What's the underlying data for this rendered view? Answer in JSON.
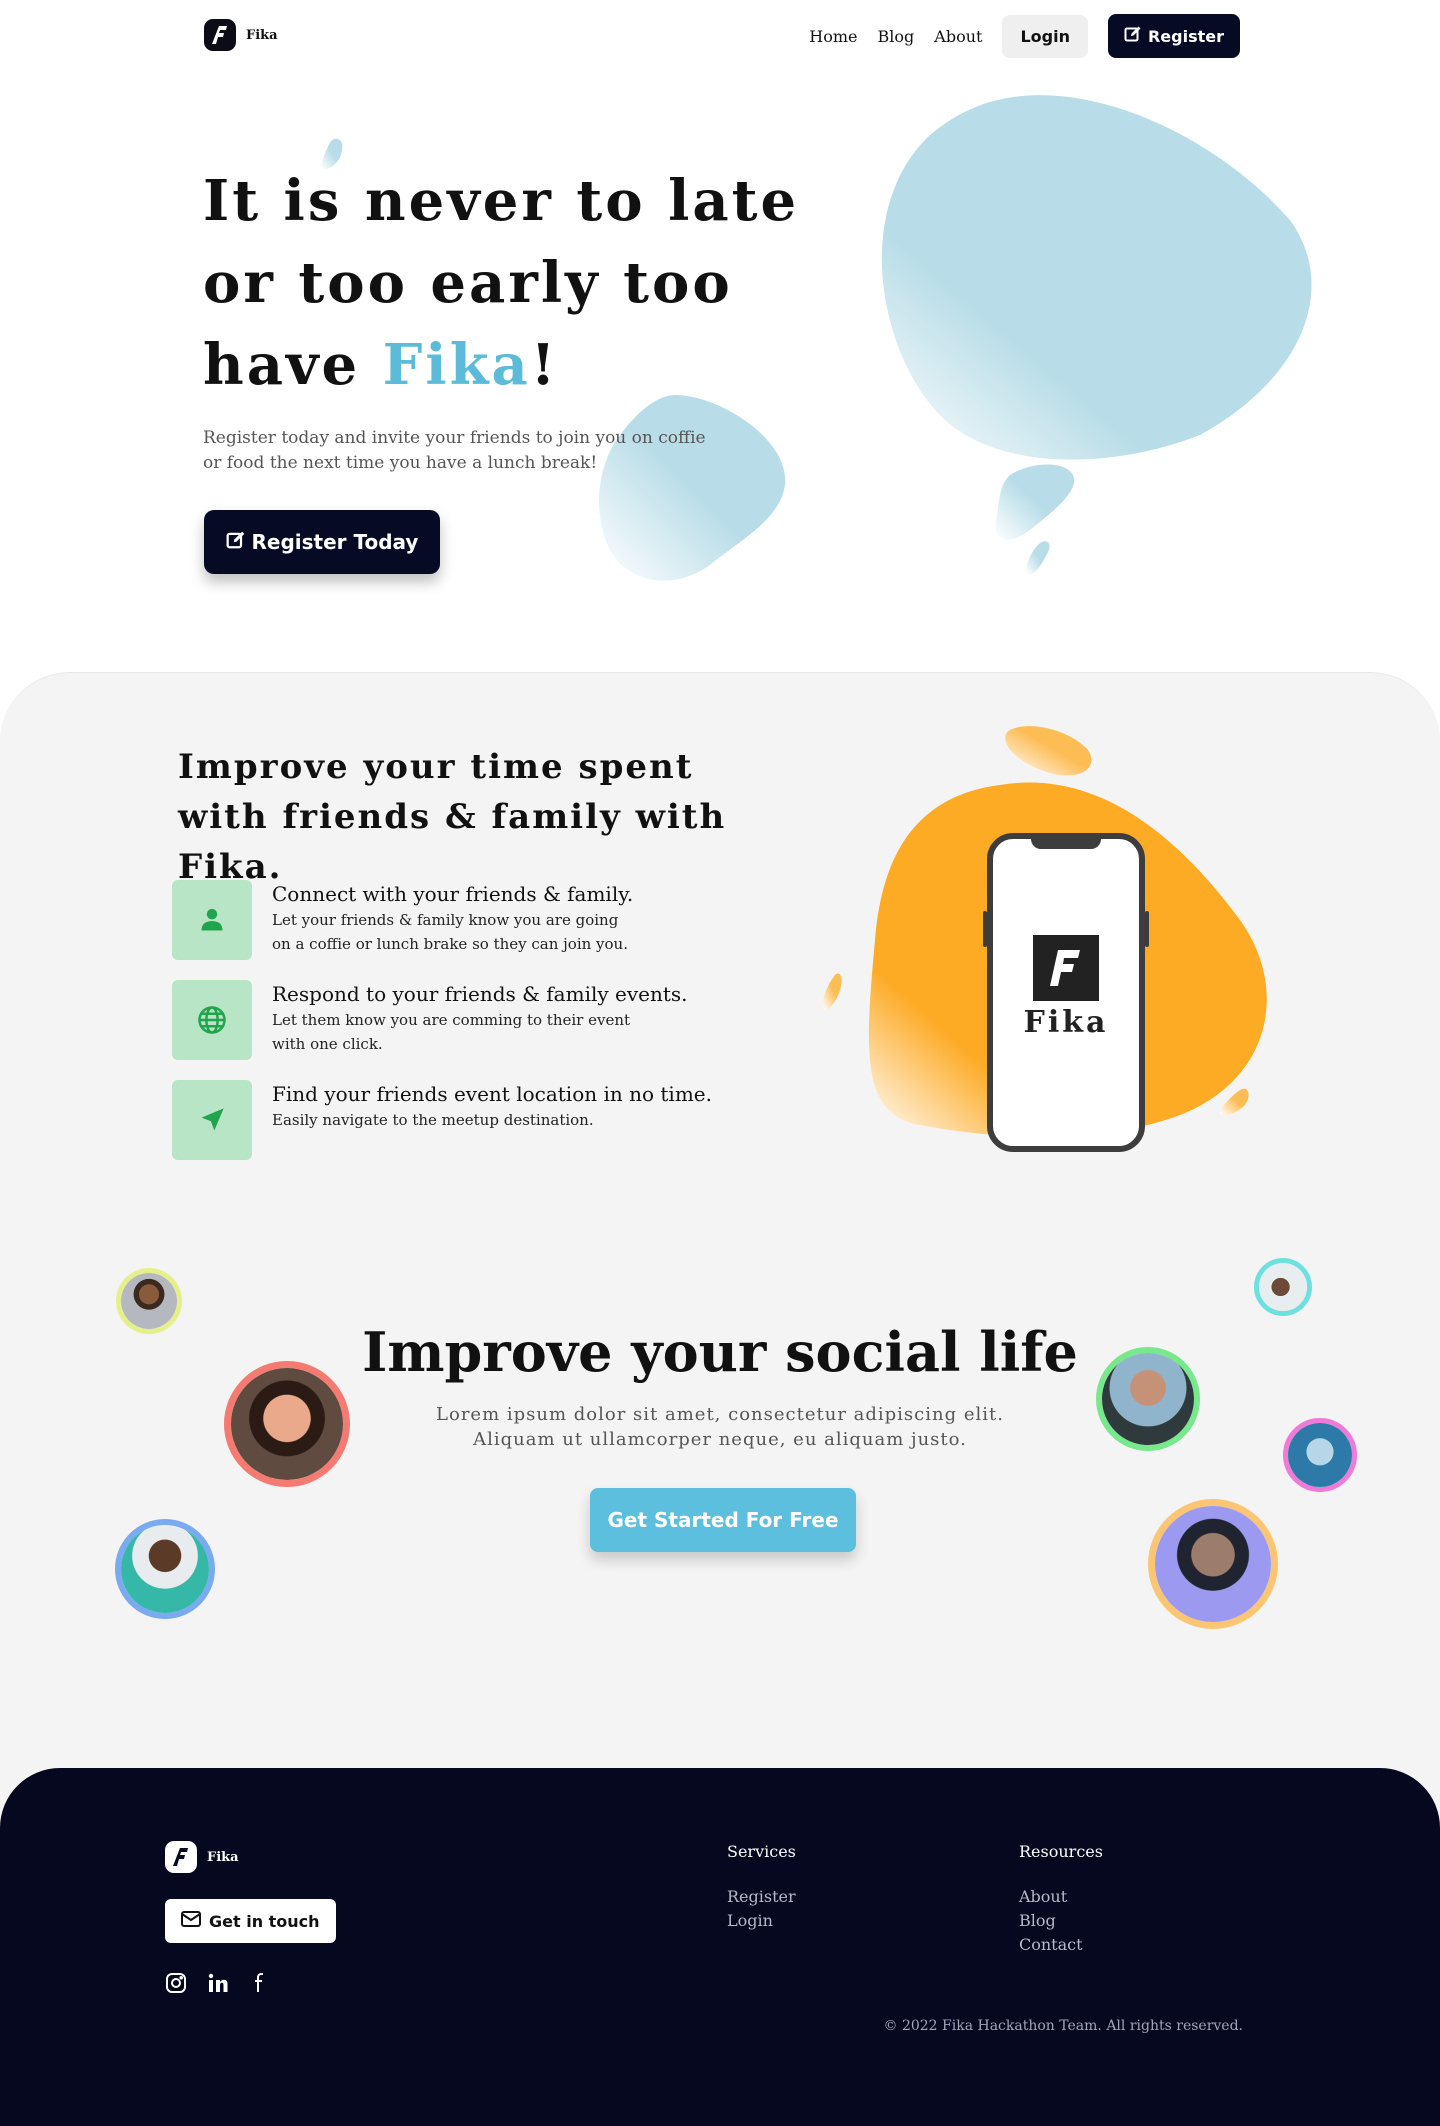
{
  "nav": {
    "logo_text": "Fika",
    "links": [
      "Home",
      "Blog",
      "About"
    ],
    "login": "Login",
    "register": "Register"
  },
  "hero": {
    "title_line1": "It is never to late",
    "title_line2": "or too early too",
    "title_line3_prefix": "have ",
    "title_accent": "Fika",
    "title_suffix": "!",
    "subtitle": "Register today and invite your friends to join you on coffie or food the next time you have a lunch break!",
    "cta": "Register Today"
  },
  "features": {
    "title": "Improve your time spent with friends & family with Fika.",
    "items": [
      {
        "icon": "user-icon",
        "heading": "Connect with your friends & family.",
        "desc": "Let your friends & family know you are going on a coffie or lunch brake so they can join you."
      },
      {
        "icon": "globe-icon",
        "heading": "Respond to your friends & family events.",
        "desc": "Let them know you are comming to their event with one click."
      },
      {
        "icon": "navigation-arrow-icon",
        "heading": "Find your friends event location in no time.",
        "desc": "Easily navigate to the meetup destination."
      }
    ],
    "phone_brand": "Fika"
  },
  "social": {
    "title": "Improve your social life",
    "subtitle_line1": "Lorem ipsum dolor sit amet, consectetur adipiscing elit.",
    "subtitle_line2": "Aliquam ut ullamcorper neque, eu aliquam justo.",
    "cta": "Get Started For Free"
  },
  "footer": {
    "logo_text": "Fika",
    "touch": "Get in touch",
    "social_icons": [
      "instagram-icon",
      "linkedin-icon",
      "facebook-icon"
    ],
    "services_title": "Services",
    "services": [
      "Register",
      "Login"
    ],
    "resources_title": "Resources",
    "resources": [
      "About",
      "Blog",
      "Contact"
    ],
    "copyright": "© 2022 Fika Hackathon Team. All rights reserved."
  },
  "colors": {
    "accent_blue": "#5bbbd8",
    "dark_navy": "#070a24",
    "feature_green": "#b8e5c6",
    "blob_orange": "#fdaa24"
  }
}
